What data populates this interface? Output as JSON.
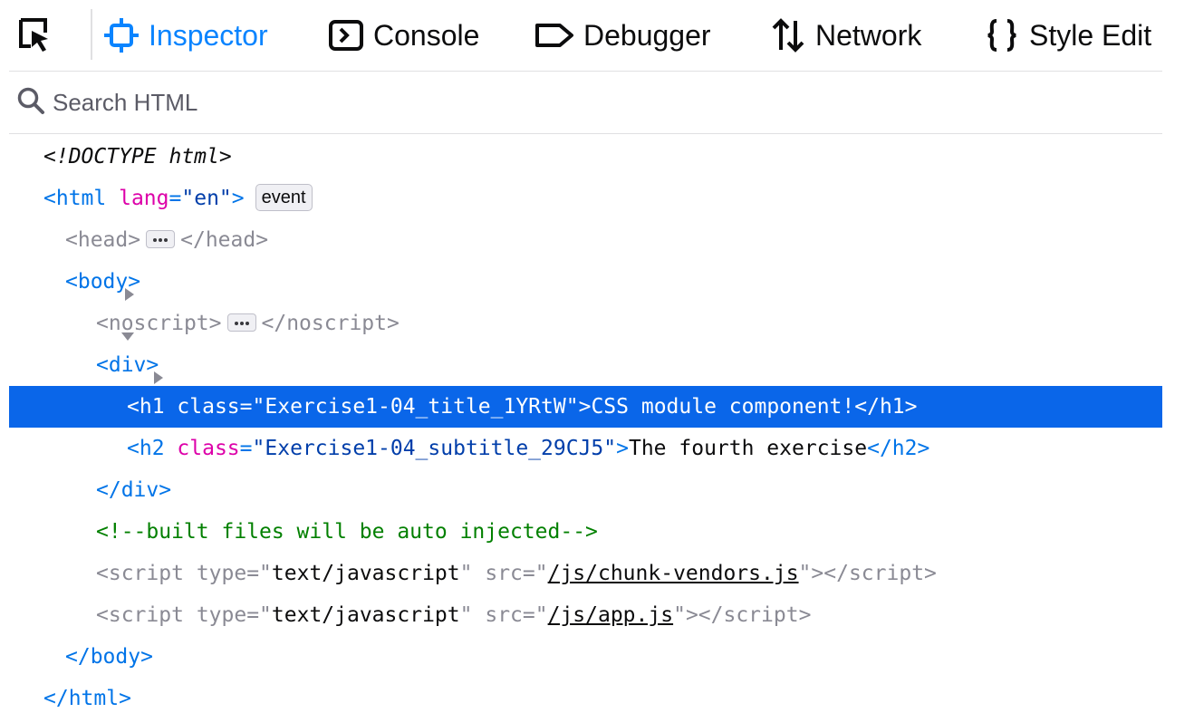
{
  "toolbar": {
    "picker_icon": "element-picker-icon",
    "tabs": [
      {
        "label": "Inspector",
        "icon": "inspector-icon",
        "selected": true
      },
      {
        "label": "Console",
        "icon": "console-icon",
        "selected": false
      },
      {
        "label": "Debugger",
        "icon": "debugger-icon",
        "selected": false
      },
      {
        "label": "Network",
        "icon": "network-icon",
        "selected": false
      },
      {
        "label": "Style Edit",
        "icon": "style-editor-icon",
        "selected": false
      }
    ]
  },
  "search": {
    "placeholder": "Search HTML",
    "value": ""
  },
  "badges": {
    "event": "event"
  },
  "tree": {
    "doctype": "<!DOCTYPE html>",
    "html_open": {
      "tag": "html",
      "attr": "lang",
      "value": "en"
    },
    "head": {
      "open": "head",
      "close": "/head"
    },
    "body_open": "body",
    "noscript": {
      "open": "noscript",
      "close": "/noscript"
    },
    "div_open": "div",
    "h1": {
      "tag": "h1",
      "attr": "class",
      "value": "Exercise1-04_title_1YRtW",
      "text": "CSS module component!",
      "close": "/h1"
    },
    "h2": {
      "tag": "h2",
      "attr": "class",
      "value": "Exercise1-04_subtitle_29CJ5",
      "text": "The fourth exercise",
      "close": "/h2"
    },
    "div_close": "/div",
    "comment": "<!--built files will be auto injected-->",
    "script1": {
      "tag": "script",
      "type_attr": "type",
      "type_value": "text/javascript",
      "src_attr": "src",
      "src_value": "/js/chunk-vendors.js",
      "close": "/script"
    },
    "script2": {
      "tag": "script",
      "type_attr": "type",
      "type_value": "text/javascript",
      "src_attr": "src",
      "src_value": "/js/app.js",
      "close": "/script"
    },
    "body_close": "/body",
    "html_close": "/html"
  },
  "colors": {
    "accent": "#0a84ff",
    "selection": "#0a66e9",
    "tag": "#0074e8",
    "attr_name": "#dd00a9",
    "attr_value": "#003eaa",
    "comment": "#028000"
  }
}
